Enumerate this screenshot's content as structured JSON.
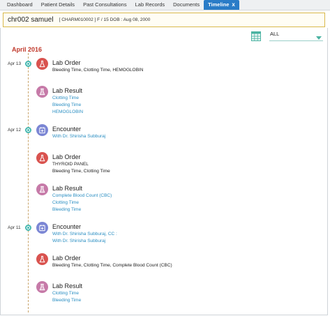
{
  "tabs": [
    {
      "label": "Dashboard",
      "active": false
    },
    {
      "label": "Patient Details",
      "active": false
    },
    {
      "label": "Past Consultations",
      "active": false
    },
    {
      "label": "Lab Records",
      "active": false
    },
    {
      "label": "Documents",
      "active": false
    },
    {
      "label": "Timeline",
      "active": true,
      "close": "x"
    }
  ],
  "patient": {
    "name": "chr002 samuel",
    "meta": "[ CHARM010002 ]  F / 15  DOB : Aug 08, 2000"
  },
  "filter": {
    "icon": "calendar-grid-icon",
    "value": "ALL"
  },
  "timeline": {
    "month": "April 2016",
    "dates": [
      {
        "label": "Apr 13"
      },
      {
        "label": "Apr 12"
      },
      {
        "label": "Apr 11"
      }
    ],
    "entries": [
      {
        "type": "Lab Order",
        "icon": "flask-icon",
        "lines": [
          {
            "text": "Bleeding Time, Clotting Time, HEMOGLOBIN",
            "style": "dark"
          }
        ]
      },
      {
        "type": "Lab Result",
        "icon": "lab-result-icon",
        "lines": [
          {
            "text": "Clotting Time",
            "style": "link"
          },
          {
            "text": "Bleeding Time",
            "style": "link"
          },
          {
            "text": "HEMOGLOBIN",
            "style": "link"
          }
        ]
      },
      {
        "type": "Encounter",
        "icon": "encounter-icon",
        "lines": [
          {
            "text": "With Dr. Shirisha Subburaj",
            "style": "link"
          }
        ]
      },
      {
        "type": "Lab Order",
        "icon": "flask-icon",
        "lines": [
          {
            "text": "THYROID PANEL",
            "style": "dark"
          },
          {
            "text": "Bleeding Time, Clotting Time",
            "style": "dark"
          }
        ]
      },
      {
        "type": "Lab Result",
        "icon": "lab-result-icon",
        "lines": [
          {
            "text": "Complete Blood Count (CBC)",
            "style": "link"
          },
          {
            "text": "Clotting Time",
            "style": "link"
          },
          {
            "text": "Bleeding Time",
            "style": "link"
          }
        ]
      },
      {
        "type": "Encounter",
        "icon": "encounter-icon",
        "lines": [
          {
            "text": "With Dr. Shirisha Subburaj, CC :",
            "style": "link"
          },
          {
            "text": "With Dr. Shirisha Subburaj",
            "style": "link"
          }
        ]
      },
      {
        "type": "Lab Order",
        "icon": "flask-icon",
        "lines": [
          {
            "text": "Bleeding Time, Clotting Time, Complete Blood Count (CBC)",
            "style": "dark"
          }
        ]
      },
      {
        "type": "Lab Result",
        "icon": "lab-result-icon",
        "lines": [
          {
            "text": "Clotting Time",
            "style": "link"
          },
          {
            "text": "Bleeding Time",
            "style": "link"
          }
        ]
      }
    ]
  },
  "colors": {
    "accent": "#2a7cc7",
    "month": "#c0392b",
    "link": "#2a8ec2",
    "order": "#d9534f",
    "result": "#c67aa8",
    "encounter": "#7b86d4",
    "dot": "#46b8b0"
  }
}
